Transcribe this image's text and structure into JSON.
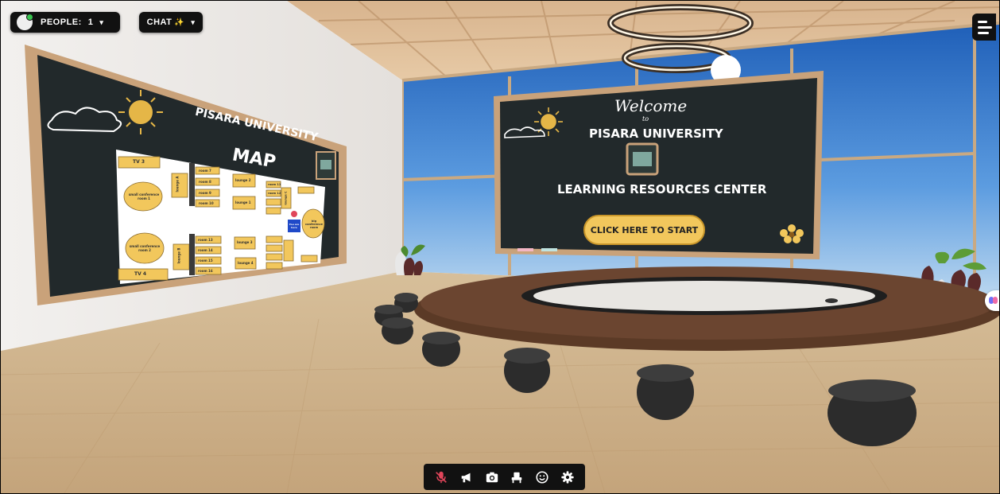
{
  "topbar": {
    "people_label": "PEOPLE:",
    "people_count": "1",
    "chat_label": "CHAT",
    "chat_sparkle": "✨"
  },
  "welcome_board": {
    "welcome": "Welcome",
    "to": "to",
    "university": "PISARA UNIVERSITY",
    "center": "LEARNING RESOURCES CENTER",
    "cta": "CLICK HERE TO START"
  },
  "map_board": {
    "title_line1": "PISARA UNIVERSITY",
    "title_line2": "MAP",
    "tv3": "TV 3",
    "tv4": "TV 4",
    "conf1": "small conference room 1",
    "conf2": "small conference room 2",
    "big_conf": "big conference room",
    "lounge_a": "lounge A",
    "lounge_b": "lounge B",
    "lounge_c": "lounge C",
    "rooms": [
      "room 7",
      "room 8",
      "room 9",
      "room 10",
      "room 11",
      "room 12",
      "room 13",
      "room 14",
      "room 15",
      "room 16"
    ],
    "lounges": [
      "lounge 2",
      "lounge 1",
      "lounge 3",
      "lounge 4"
    ],
    "you_are_here": "You are here"
  },
  "toolbar": {
    "items": [
      "mic-off",
      "megaphone",
      "camera",
      "seat",
      "emoji",
      "settings"
    ]
  },
  "colors": {
    "accent": "#f2c75c",
    "chalkboard": "#22292b",
    "frame_wood": "#c9a27a",
    "mic_off": "#e0455a"
  }
}
